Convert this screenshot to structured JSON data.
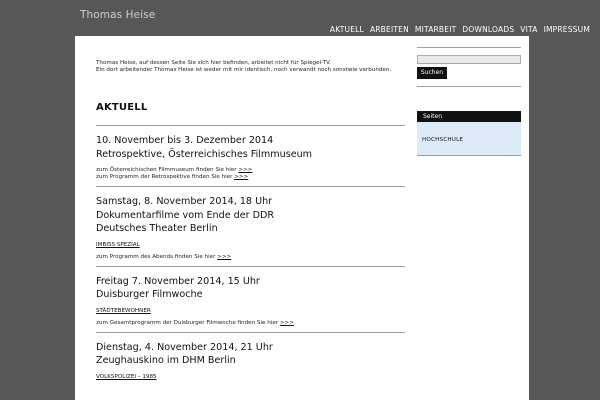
{
  "site": {
    "title": "Thomas Heise"
  },
  "nav": {
    "items": [
      {
        "label": "AKTUELL"
      },
      {
        "label": "ARBEITEN"
      },
      {
        "label": "MITARBEIT"
      },
      {
        "label": "DOWNLOADS"
      },
      {
        "label": "VITA"
      },
      {
        "label": "IMPRESSUM"
      }
    ]
  },
  "disclaimer": {
    "line1": "Thomas Heise, auf dessen Seite Sie sich hier befinden, arbeitet nicht für Spiegel-TV.",
    "line2": "Ein dort arbeitender Thomas Heise ist weder mit mir identisch, noch verwandt noch sonstwie verbunden."
  },
  "section": {
    "title": "AKTUELL"
  },
  "events": [
    {
      "title_lines": [
        "10. November bis 3. Dezember 2014",
        "Retrospektive, Österreichisches Filmmuseum"
      ],
      "links": [
        {
          "text": "zum Österreichischen Filmmuseum finden Sie hier",
          "more": ">>>"
        },
        {
          "text": "zum Programm der Retrospektive finden Sie hier",
          "more": ">>>"
        }
      ]
    },
    {
      "title_lines": [
        "Samstag, 8. November 2014, 18 Uhr",
        "Dokumentarfilme vom Ende der DDR",
        "Deutsches Theater Berlin"
      ],
      "extra": "IMBISS SPEZIAL",
      "links": [
        {
          "text": "zum Programm des Abends finden Sie hier",
          "more": ">>>"
        }
      ]
    },
    {
      "title_lines": [
        "Freitag 7. November 2014, 15 Uhr",
        "Duisburger Filmwoche"
      ],
      "extra": "STÄDTEBEWOHNER",
      "links": [
        {
          "text": "zum Gesamtprogramm der Duisburger Filmwoche finden Sie hier",
          "more": ">>>"
        }
      ]
    },
    {
      "title_lines": [
        "Dienstag, 4. November 2014, 21 Uhr",
        "Zeughauskino im DHM Berlin"
      ],
      "extra": "VOLKSPOLIZEI – 1985"
    }
  ],
  "sidebar": {
    "search_button": "Suchen",
    "pages_heading": "Seiten",
    "pages": [
      {
        "label": "HOCHSCHULE"
      }
    ]
  }
}
